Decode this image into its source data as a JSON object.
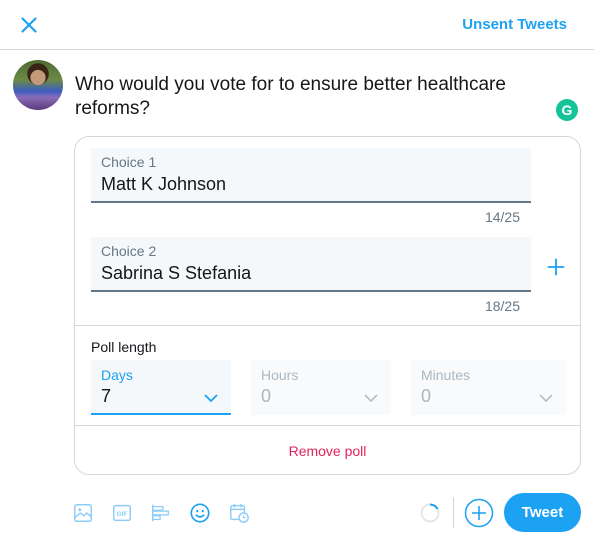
{
  "header": {
    "close_icon": "close-icon",
    "unsent_tweets_label": "Unsent Tweets"
  },
  "composer": {
    "avatar_alt": "User avatar",
    "text": "Who would you vote for to ensure better healthcare reforms?",
    "grammarly_badge": "G"
  },
  "poll": {
    "choices": [
      {
        "label": "Choice 1",
        "value": "Matt K Johnson",
        "counter": "14/25"
      },
      {
        "label": "Choice 2",
        "value": "Sabrina S Stefania",
        "counter": "18/25"
      }
    ],
    "add_choice_icon": "plus-icon",
    "length_label": "Poll length",
    "length": {
      "days": {
        "label": "Days",
        "value": "7"
      },
      "hours": {
        "label": "Hours",
        "value": "0"
      },
      "minutes": {
        "label": "Minutes",
        "value": "0"
      }
    },
    "remove_label": "Remove poll"
  },
  "toolbar": {
    "icons": [
      "image-icon",
      "gif-icon",
      "poll-icon",
      "emoji-icon",
      "schedule-icon"
    ],
    "tweet_label": "Tweet"
  },
  "colors": {
    "accent": "#1da1f2",
    "danger": "#e0245e",
    "grammarly": "#15c39a"
  }
}
